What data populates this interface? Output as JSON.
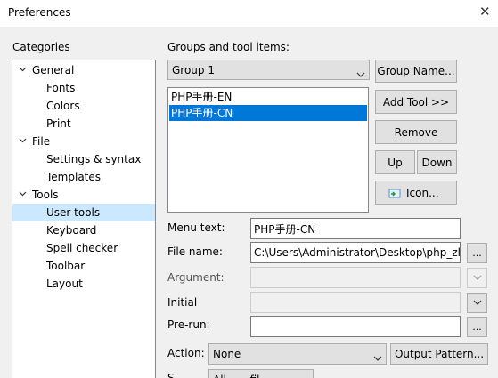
{
  "window": {
    "title": "Preferences"
  },
  "categories": {
    "heading": "Categories",
    "items": [
      {
        "label": "General",
        "expanded": true
      },
      {
        "label": "Fonts"
      },
      {
        "label": "Colors"
      },
      {
        "label": "Print"
      },
      {
        "label": "File",
        "expanded": true
      },
      {
        "label": "Settings & syntax"
      },
      {
        "label": "Templates"
      },
      {
        "label": "Tools",
        "expanded": true
      },
      {
        "label": "User tools",
        "selected": true
      },
      {
        "label": "Keyboard"
      },
      {
        "label": "Spell checker"
      },
      {
        "label": "Toolbar"
      },
      {
        "label": "Layout"
      }
    ]
  },
  "groups": {
    "heading": "Groups and tool items:",
    "selected_group": "Group 1",
    "tools": [
      "PHP手册-EN",
      "PHP手册-CN"
    ],
    "selected_tool_index": 1
  },
  "buttons": {
    "group_name": "Group Name...",
    "add_tool": "Add Tool >>",
    "remove": "Remove",
    "up": "Up",
    "down": "Down",
    "icon": "Icon...",
    "browse": "...",
    "output_pattern": "Output Pattern..."
  },
  "fields": {
    "menu_text_label": "Menu text:",
    "menu_text_value": "PHP手册-CN",
    "file_name_label": "File name:",
    "file_name_value": "C:\\Users\\Administrator\\Desktop\\php_zl",
    "argument_label": "Argument:",
    "argument_value": "",
    "initial_label": "Initial",
    "initial_value": "",
    "prerun_label": "Pre-run:",
    "prerun_value": "",
    "action_label": "Action:",
    "action_value": "None",
    "save_label": "S",
    "save_value": "All... ...fil..."
  },
  "colors": {
    "selection_blue": "#0078d7",
    "tree_selection": "#cce8ff"
  }
}
